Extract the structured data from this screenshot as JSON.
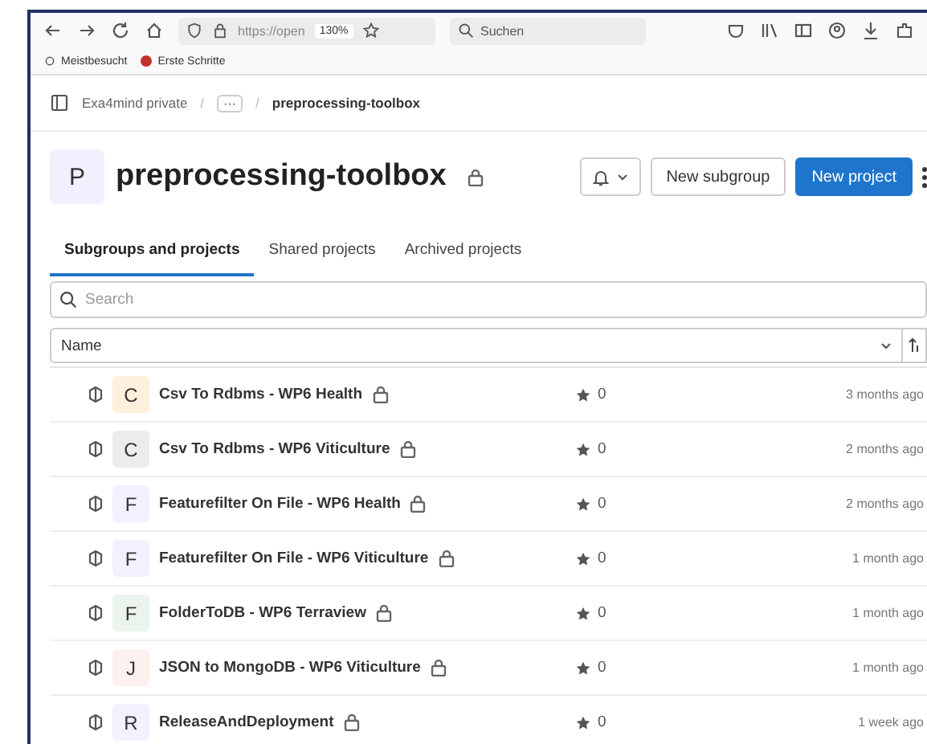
{
  "browser": {
    "url": "https://open",
    "zoom": "130%",
    "search": "Suchen",
    "bookmarks": [
      "Meistbesucht",
      "Erste Schritte"
    ]
  },
  "breadcrumb": {
    "items": [
      "Exa4mind private",
      "···",
      "preprocessing-toolbox"
    ],
    "separators": [
      "/",
      "/"
    ]
  },
  "group": {
    "avatar": "P",
    "title": "preprocessing-toolbox",
    "buttons": [
      "New subgroup",
      "New project"
    ]
  },
  "tabs": [
    {
      "label": "Subgroups and projects",
      "selected": true
    },
    {
      "label": "Shared projects",
      "selected": false
    },
    {
      "label": "Archived projects",
      "selected": false
    }
  ],
  "search": {
    "placeholder": "Search"
  },
  "sort": {
    "label": "Name"
  },
  "rows": [
    {
      "avatar": "C",
      "color": "#fdf1dd",
      "name": "Csv To Rdbms - WP6 Health",
      "stars": "0",
      "updated": "3 months ago"
    },
    {
      "avatar": "C",
      "color": "#ececef",
      "name": "Csv To Rdbms - WP6 Viticulture",
      "stars": "0",
      "updated": "2 months ago"
    },
    {
      "avatar": "F",
      "color": "#f1f1ff",
      "name": "Featurefilter On File - WP6 Health",
      "stars": "0",
      "updated": "2 months ago"
    },
    {
      "avatar": "F",
      "color": "#f1f1ff",
      "name": "Featurefilter On File - WP6 Viticulture",
      "stars": "0",
      "updated": "1 month ago"
    },
    {
      "avatar": "F",
      "color": "#ecf4ee",
      "name": "FolderToDB - WP6 Terraview",
      "stars": "0",
      "updated": "1 month ago"
    },
    {
      "avatar": "J",
      "color": "#fcf1ef",
      "name": "JSON to MongoDB - WP6 Viticulture",
      "stars": "0",
      "updated": "1 month ago"
    },
    {
      "avatar": "R",
      "color": "#f1f1ff",
      "name": "ReleaseAndDeployment",
      "stars": "0",
      "updated": "1 week ago"
    }
  ]
}
